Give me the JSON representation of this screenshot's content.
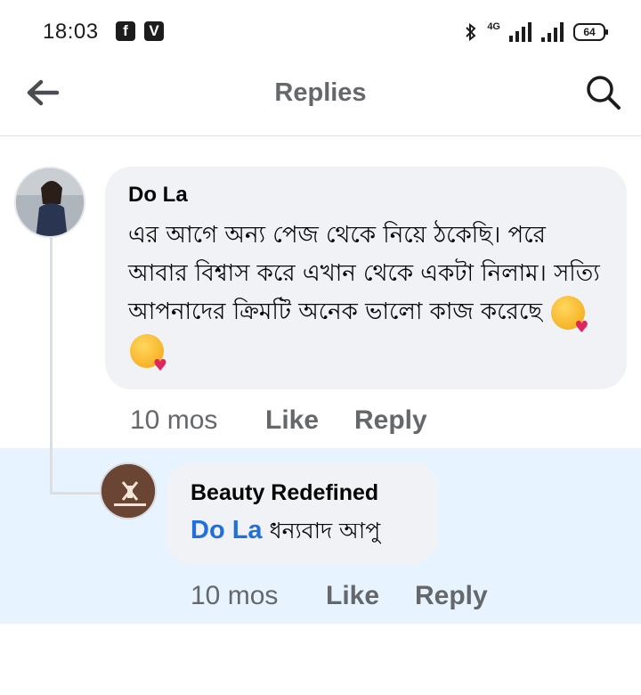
{
  "status_bar": {
    "time": "18:03",
    "app_icons": [
      "f",
      "V"
    ],
    "network": "4G",
    "battery": "64"
  },
  "header": {
    "title": "Replies",
    "back_icon": "arrow-left-icon",
    "search_icon": "search-icon"
  },
  "comment": {
    "author": "Do La",
    "text": "এর আগে অন্য পেজ থেকে নিয়ে ঠকেছি। পরে আবার বিশ্বাস করে এখান থেকে একটা নিলাম। সত্যি আপনাদের ক্রিমটি অনেক ভালো কাজ করেছে",
    "emojis": [
      "kiss-heart-emoji",
      "kiss-heart-emoji"
    ],
    "time": "10 mos",
    "like": "Like",
    "reply": "Reply"
  },
  "reply": {
    "author": "Beauty Redefined",
    "mention": "Do La",
    "text": "ধন্যবাদ আপু",
    "time": "10 mos",
    "like": "Like",
    "reply": "Reply"
  },
  "colors": {
    "highlight_bg": "#e7f3ff",
    "bubble_bg": "#f0f2f5",
    "mention": "#216fdb",
    "meta": "#65676b"
  }
}
